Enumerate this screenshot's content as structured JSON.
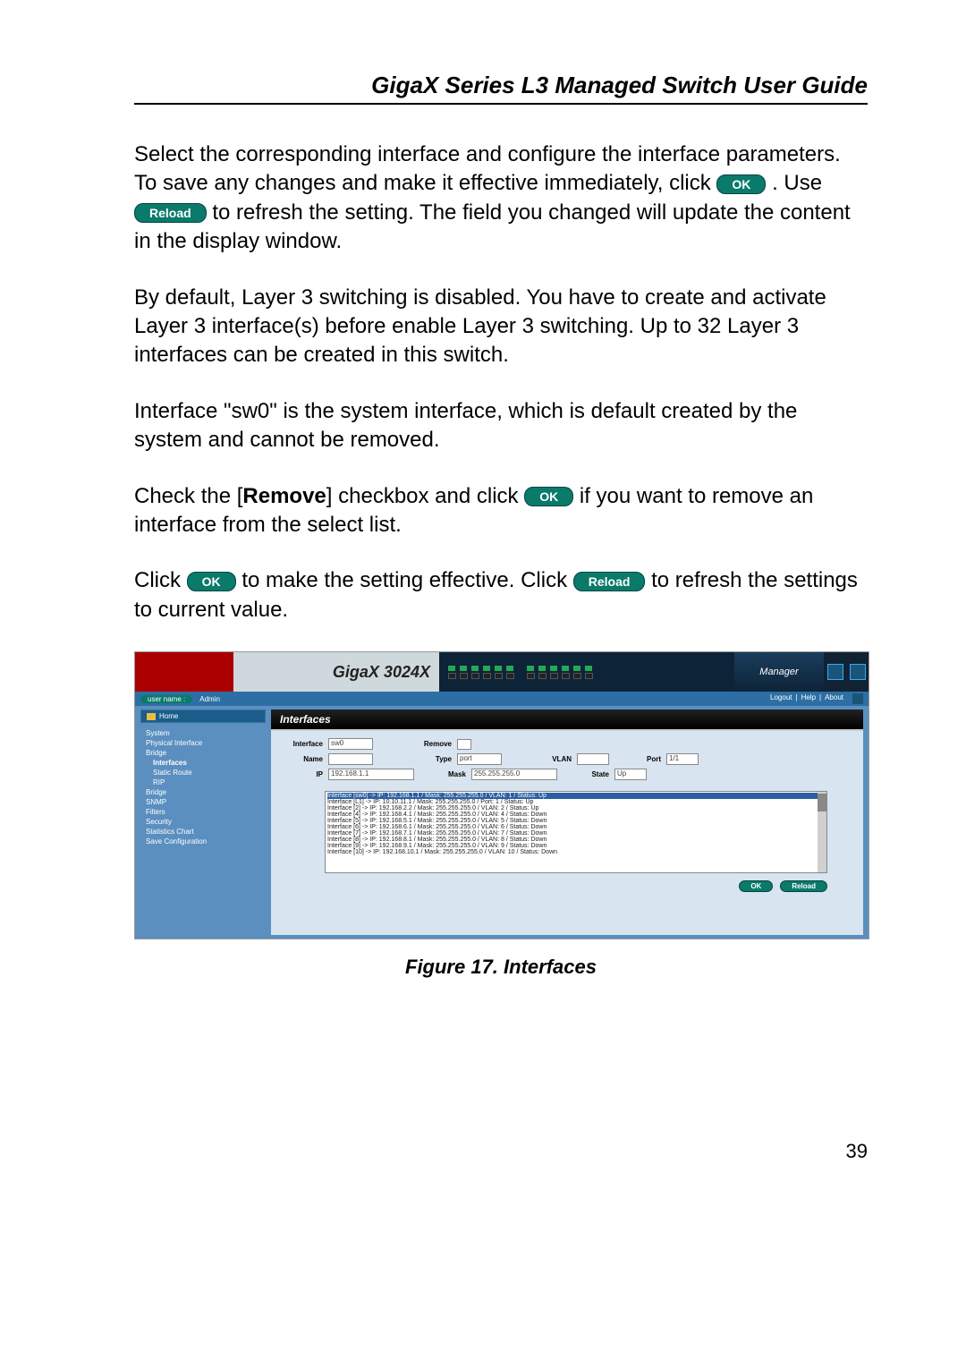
{
  "header": {
    "title": "GigaX Series L3 Managed Switch User Guide"
  },
  "para1_a": "Select the corresponding interface and configure the interface parameters. To save any changes and make it effective immediately, click ",
  "btn_ok": "OK",
  "para1_b": ". Use ",
  "btn_reload": "Reload",
  "para1_c": " to refresh the setting. The field you changed will update the content in the display window.",
  "para2": "By default, Layer 3 switching is disabled. You have to create and activate Layer 3 interface(s) before enable Layer 3 switching. Up to 32 Layer 3 interfaces can be created in this switch.",
  "para3": "Interface \"sw0\" is the system interface, which is default created by the system and cannot be removed.",
  "para4_a": "Check the [",
  "para4_bold": "Remove",
  "para4_b": "] checkbox and click ",
  "para4_c": " if you want to remove an interface from the select list.",
  "para5_a": "Click ",
  "para5_b": " to make the setting effective. Click ",
  "para5_c": " to refresh the settings to current value.",
  "screenshot": {
    "brand": "GigaX 3024X",
    "manager": "Manager",
    "user_label": "user name :",
    "user_value": "Admin",
    "topnav": [
      "Logout",
      "Help",
      "About"
    ],
    "home": "Home",
    "nav": [
      {
        "label": "System",
        "indent": false
      },
      {
        "label": "Physical Interface",
        "indent": false
      },
      {
        "label": "Bridge",
        "indent": false
      },
      {
        "label": "Interfaces",
        "indent": true,
        "selected": true
      },
      {
        "label": "Static Route",
        "indent": true
      },
      {
        "label": "RIP",
        "indent": true
      },
      {
        "label": "Bridge",
        "indent": false
      },
      {
        "label": "SNMP",
        "indent": false
      },
      {
        "label": "Filters",
        "indent": false
      },
      {
        "label": "Security",
        "indent": false
      },
      {
        "label": "Statistics Chart",
        "indent": false
      },
      {
        "label": "Save Configuration",
        "indent": false
      }
    ],
    "panel_title": "Interfaces",
    "form": {
      "interface_label": "Interface",
      "interface_value": "sw0",
      "remove_label": "Remove",
      "name_label": "Name",
      "name_value": "",
      "type_label": "Type",
      "type_value": "port",
      "vlan_label": "VLAN",
      "vlan_value": "",
      "port_label": "Port",
      "port_value": "1/1",
      "ip_label": "IP",
      "ip_value": "192.168.1.1",
      "mask_label": "Mask",
      "mask_value": "255.255.255.0",
      "state_label": "State",
      "state_value": "Up"
    },
    "list": [
      "Interface [sw0] -> IP: 192.168.1.1 / Mask: 255.255.255.0 / VLAN: 1 / Status: Up",
      "Interface [L1] -> IP: 10.10.11.1 / Mask: 255.255.255.0 / Port: 1 / Status: Up",
      "Interface [2] -> IP: 192.168.2.2 / Mask: 255.255.255.0 / VLAN: 2 / Status: Up",
      "Interface [4] -> IP: 192.168.4.1 / Mask: 255.255.255.0 / VLAN: 4 / Status: Down",
      "Interface [5] -> IP: 192.168.5.1 / Mask: 255.255.255.0 / VLAN: 5 / Status: Down",
      "Interface [6] -> IP: 192.168.6.1 / Mask: 255.255.255.0 / VLAN: 6 / Status: Down",
      "Interface [7] -> IP: 192.168.7.1 / Mask: 255.255.255.0 / VLAN: 7 / Status: Down",
      "Interface [8] -> IP: 192.168.8.1 / Mask: 255.255.255.0 / VLAN: 8 / Status: Down",
      "Interface [9] -> IP: 192.168.9.1 / Mask: 255.255.255.0 / VLAN: 9 / Status: Down",
      "Interface [10] -> IP: 192.168.10.1 / Mask: 255.255.255.0 / VLAN: 10 / Status: Down"
    ],
    "buttons": {
      "ok": "OK",
      "reload": "Reload"
    }
  },
  "figure_caption": "Figure 17.  Interfaces",
  "page_number": "39"
}
